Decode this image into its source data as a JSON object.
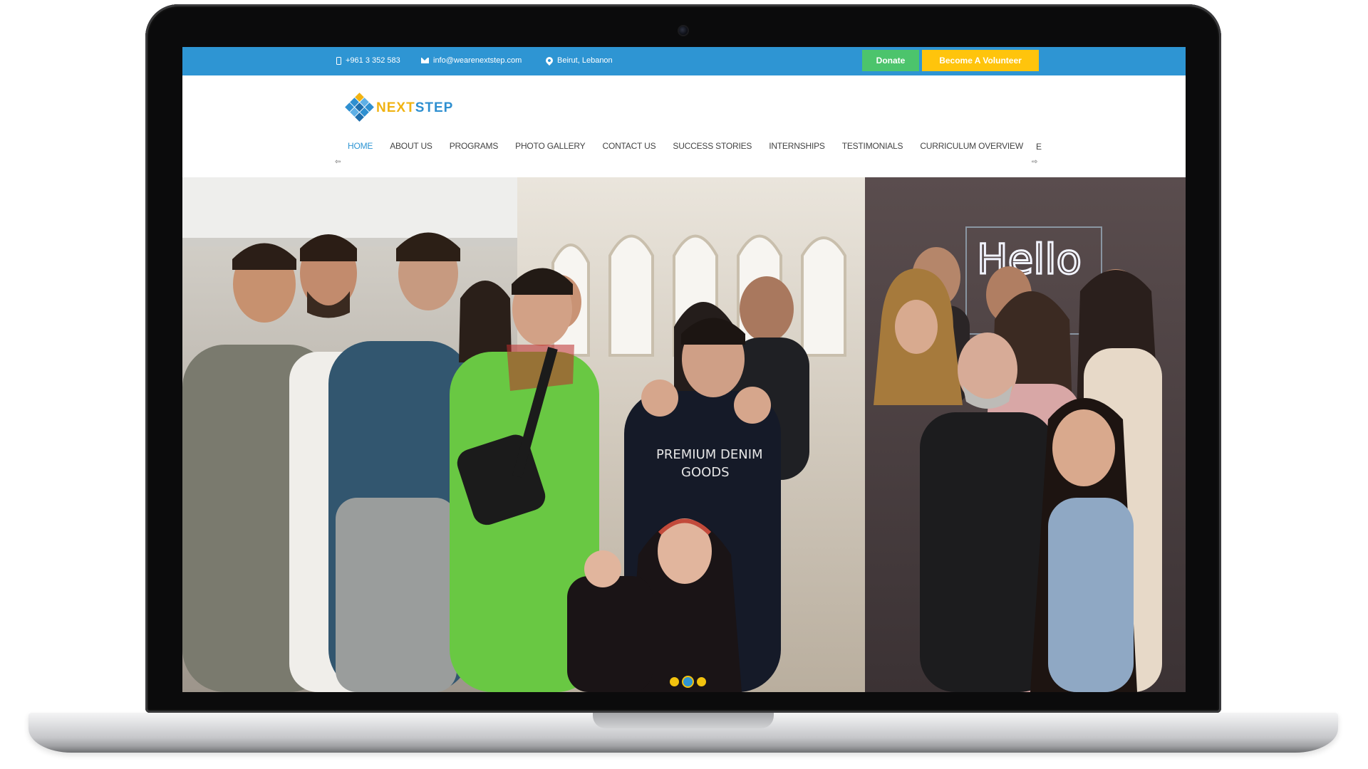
{
  "topbar": {
    "phone": "+961 3 352 583",
    "email": "info@wearenextstep.com",
    "location": "Beirut, Lebanon",
    "donate_label": "Donate",
    "volunteer_label": "Become A Volunteer",
    "colors": {
      "bar": "#2e95d3",
      "donate": "#4cc46c",
      "volunteer": "#ffc40c"
    }
  },
  "logo": {
    "part1": "NEXT",
    "part2": "STEP"
  },
  "nav": {
    "items": [
      "HOME",
      "ABOUT US",
      "PROGRAMS",
      "PHOTO GALLERY",
      "CONTACT US",
      "SUCCESS STORIES",
      "INTERNSHIPS",
      "TESTIMONIALS",
      "CURRICULUM OVERVIEW"
    ],
    "overflow": "E",
    "arrow_left": "⇦",
    "arrow_right": "⇨"
  },
  "hero": {
    "slides": 3,
    "active_slide": 2
  }
}
